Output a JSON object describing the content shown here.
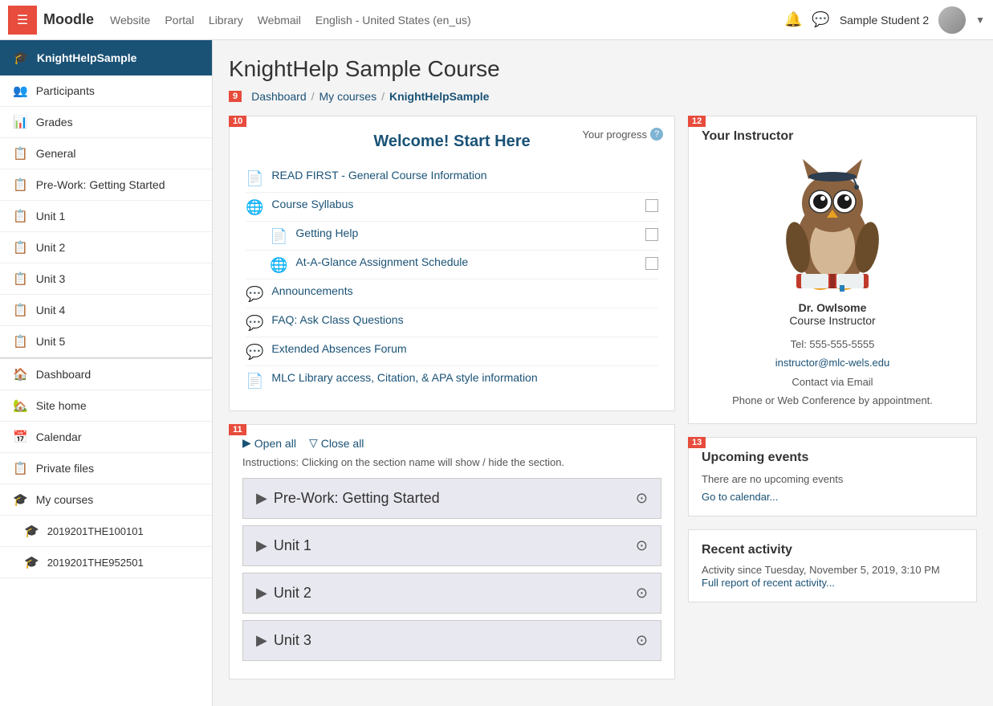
{
  "topnav": {
    "logo": "Moodle",
    "links": [
      "Website",
      "Portal",
      "Library",
      "Webmail"
    ],
    "language": "English - United States (en_us)",
    "user": "Sample Student 2"
  },
  "sidebar": {
    "course_label": "KnightHelpSample",
    "items": [
      {
        "id": "participants",
        "icon": "👥",
        "label": "Participants"
      },
      {
        "id": "grades",
        "icon": "📊",
        "label": "Grades"
      },
      {
        "id": "general",
        "icon": "📋",
        "label": "General"
      },
      {
        "id": "prework",
        "icon": "📋",
        "label": "Pre-Work: Getting Started"
      },
      {
        "id": "unit1",
        "icon": "📋",
        "label": "Unit 1"
      },
      {
        "id": "unit2",
        "icon": "📋",
        "label": "Unit 2"
      },
      {
        "id": "unit3",
        "icon": "📋",
        "label": "Unit 3"
      },
      {
        "id": "unit4",
        "icon": "📋",
        "label": "Unit 4"
      },
      {
        "id": "unit5",
        "icon": "📋",
        "label": "Unit 5"
      }
    ],
    "nav_items": [
      {
        "id": "dashboard",
        "icon": "🏠",
        "label": "Dashboard"
      },
      {
        "id": "sitehome",
        "icon": "🏡",
        "label": "Site home"
      },
      {
        "id": "calendar",
        "icon": "📅",
        "label": "Calendar"
      },
      {
        "id": "privatefiles",
        "icon": "📋",
        "label": "Private files"
      },
      {
        "id": "mycourses",
        "icon": "🎓",
        "label": "My courses"
      }
    ],
    "my_courses": [
      {
        "id": "course1",
        "icon": "🎓",
        "label": "2019201THE100101"
      },
      {
        "id": "course2",
        "icon": "🎓",
        "label": "2019201THE952501"
      }
    ]
  },
  "breadcrumb": {
    "badge": "9",
    "items": [
      "Dashboard",
      "My courses",
      "KnightHelpSample"
    ]
  },
  "page_title": "KnightHelp Sample Course",
  "welcome_section": {
    "badge": "10",
    "progress_label": "Your progress",
    "title": "Welcome! Start Here",
    "items": [
      {
        "id": "read-first",
        "icon": "📄",
        "label": "READ FIRST - General Course Information",
        "has_checkbox": false
      },
      {
        "id": "syllabus",
        "icon": "🌐",
        "label": "Course Syllabus",
        "has_checkbox": true
      },
      {
        "id": "getting-help",
        "icon": "📄",
        "label": "Getting Help",
        "has_checkbox": true
      },
      {
        "id": "at-a-glance",
        "icon": "🌐",
        "label": "At-A-Glance Assignment Schedule",
        "has_checkbox": true
      },
      {
        "id": "announcements",
        "icon": "💬",
        "label": "Announcements",
        "has_checkbox": false
      },
      {
        "id": "faq",
        "icon": "💬",
        "label": "FAQ: Ask Class Questions",
        "has_checkbox": false
      },
      {
        "id": "absences",
        "icon": "💬",
        "label": "Extended Absences Forum",
        "has_checkbox": false
      },
      {
        "id": "library",
        "icon": "📄",
        "label": "MLC Library access, Citation, & APA style information",
        "has_checkbox": false
      }
    ]
  },
  "sections": {
    "badge": "11",
    "open_all": "Open all",
    "close_all": "Close all",
    "instructions": "Instructions: Clicking on the section name will show / hide the section.",
    "units": [
      {
        "id": "prework",
        "label": "Pre-Work: Getting Started"
      },
      {
        "id": "unit1",
        "label": "Unit 1"
      },
      {
        "id": "unit2",
        "label": "Unit 2"
      },
      {
        "id": "unit3",
        "label": "Unit 3"
      }
    ]
  },
  "instructor": {
    "badge": "12",
    "section_title": "Your Instructor",
    "name": "Dr. Owlsome",
    "role": "Course Instructor",
    "tel": "Tel: 555-555-5555",
    "email": "instructor@mlc-wels.edu",
    "contact_note": "Contact via Email",
    "phone_note": "Phone or Web Conference by appointment."
  },
  "upcoming": {
    "badge": "13",
    "title": "Upcoming events",
    "no_events": "There are no upcoming events",
    "calendar_link": "Go to calendar..."
  },
  "recent": {
    "title": "Recent activity",
    "activity_since": "Activity since Tuesday, November 5, 2019, 3:10 PM",
    "link": "Full report of recent activity..."
  }
}
